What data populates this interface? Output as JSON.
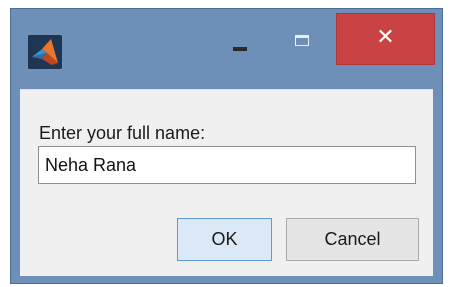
{
  "window": {
    "close_glyph": "✕",
    "icon": "matlab-logo-icon"
  },
  "dialog": {
    "prompt": "Enter your full name:",
    "input_value": "Neha Rana",
    "ok_label": "OK",
    "cancel_label": "Cancel"
  },
  "colors": {
    "title_bar": "#6d8fb8",
    "close_button": "#c94345",
    "dialog_bg": "#f0f0f0",
    "ok_border": "#5b9bd5"
  }
}
